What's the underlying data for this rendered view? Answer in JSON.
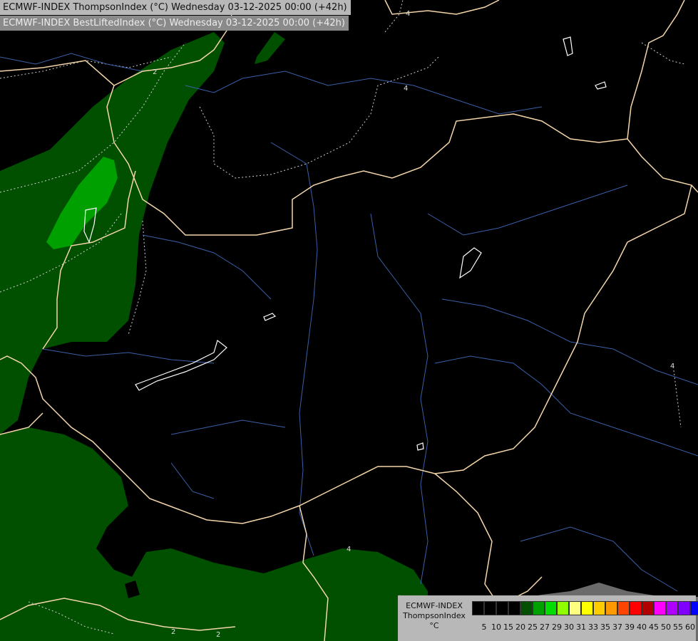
{
  "header": {
    "line1": "ECMWF-INDEX ThompsonIndex (°C) Wednesday 03-12-2025 00:00 (+42h)",
    "line2": "ECMWF-INDEX BestLiftedIndex (°C) Wednesday 03-12-2025 00:00 (+42h)"
  },
  "legend": {
    "model": "ECMWF-INDEX",
    "parameter": "ThompsonIndex",
    "unit": "°C",
    "ticks": [
      "5",
      "10",
      "15",
      "20",
      "25",
      "27",
      "29",
      "30",
      "31",
      "33",
      "35",
      "37",
      "39",
      "40",
      "45",
      "50",
      "55",
      "60"
    ],
    "colors": [
      "#000000",
      "#000000",
      "#000000",
      "#000000",
      "#005000",
      "#00a000",
      "#00dd00",
      "#90ff00",
      "#ffff80",
      "#ffff00",
      "#ffcc00",
      "#ff9900",
      "#ff4400",
      "#ff0000",
      "#b00000",
      "#ff00ff",
      "#b000ff",
      "#8000ff",
      "#0000ff"
    ]
  },
  "map": {
    "contour_labels": [
      "2",
      "2",
      "2",
      "4",
      "4",
      "4",
      "4"
    ],
    "colors": {
      "background": "#000000",
      "field_dark_green": "#005000",
      "field_mid_green": "#00a000",
      "field_light": "#b0b0b0",
      "country_borders": "#f5d6aa",
      "rivers": "#3a5fa8",
      "lakes": "#ffffff",
      "contours": "#cfcfcf"
    }
  }
}
